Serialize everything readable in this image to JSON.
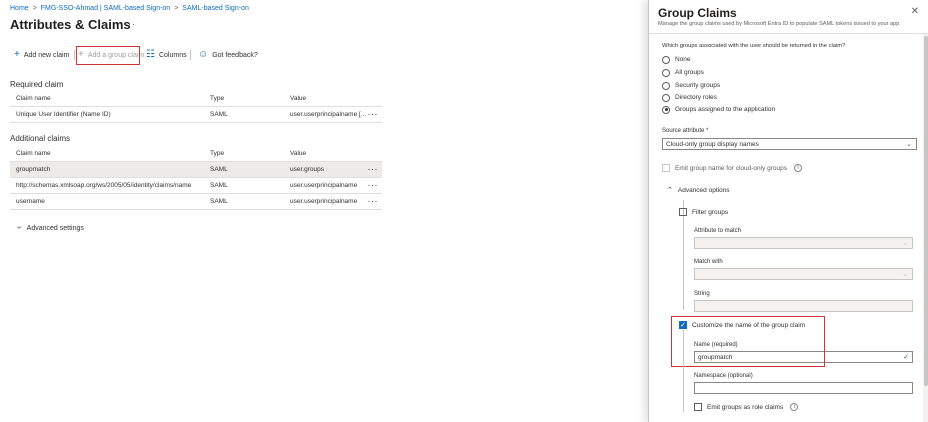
{
  "breadcrumb": [
    "Home",
    "FMG-SSO-Ahmad | SAML-based Sign-on",
    "SAML-based Sign-on"
  ],
  "page_title": "Attributes & Claims",
  "title_more": "···",
  "toolbar": {
    "add_new_claim": "Add new claim",
    "add_group_claim": "Add a group claim",
    "columns": "Columns",
    "feedback": "Got feedback?"
  },
  "required": {
    "title": "Required claim",
    "headers": [
      "Claim name",
      "Type",
      "Value"
    ],
    "rows": [
      {
        "name": "Unique User Identifier (Name ID)",
        "type": "SAML",
        "value": "user.userprincipalname [..."
      }
    ]
  },
  "additional": {
    "title": "Additional claims",
    "headers": [
      "Claim name",
      "Type",
      "Value"
    ],
    "rows": [
      {
        "name": "groupmatch",
        "type": "SAML",
        "value": "user.groups"
      },
      {
        "name": "http://schemas.xmlsoap.org/ws/2005/05/identity/claims/name",
        "type": "SAML",
        "value": "user.userprincipalname"
      },
      {
        "name": "username",
        "type": "SAML",
        "value": "user.userprincipalname"
      }
    ]
  },
  "advanced_settings": "Advanced settings",
  "panel": {
    "title": "Group Claims",
    "subtitle": "Manage the group claims used by Microsoft Entra ID to populate SAML tokens issued to your app",
    "question": "Which groups associated with the user should be returned in the claim?",
    "options": [
      "None",
      "All groups",
      "Security groups",
      "Directory roles",
      "Groups assigned to the application"
    ],
    "selected_option": "Groups assigned to the application",
    "source_attribute_label": "Source attribute *",
    "source_attribute_value": "Cloud-only group display names",
    "emit_group_name": "Emit group name for cloud-only groups",
    "advanced_options": "Advanced options",
    "filter_groups": "Filter groups",
    "attribute_to_match": "Attribute to match",
    "match_with": "Match with",
    "string": "String",
    "customize_name": "Customize the name of the group claim",
    "name_label": "Name (required)",
    "name_value": "groupmatch",
    "namespace_label": "Namespace (optional)",
    "emit_role_claims": "Emit groups as role claims"
  },
  "colors": {
    "accent": "#0f6cbd",
    "highlight_box": "#d13438",
    "valid": "#107c10"
  }
}
